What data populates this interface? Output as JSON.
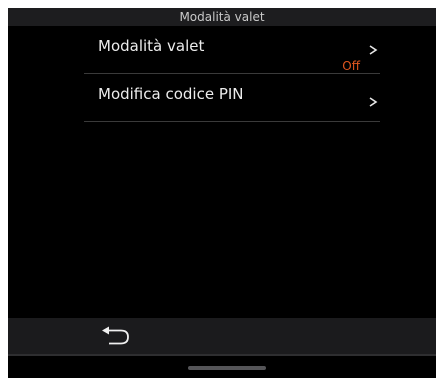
{
  "header": {
    "title": "Modalità valet"
  },
  "menu": {
    "items": [
      {
        "label": "Modalità valet",
        "value": "Off",
        "icon": "chevron-right-icon"
      },
      {
        "label": "Modifica codice PIN",
        "icon": "chevron-right-icon"
      }
    ]
  },
  "footer": {
    "back_icon": "back-arrow-icon"
  },
  "colors": {
    "background": "#000000",
    "bar": "#1d1d1f",
    "accent": "#e0561f",
    "text": "#ececec"
  }
}
